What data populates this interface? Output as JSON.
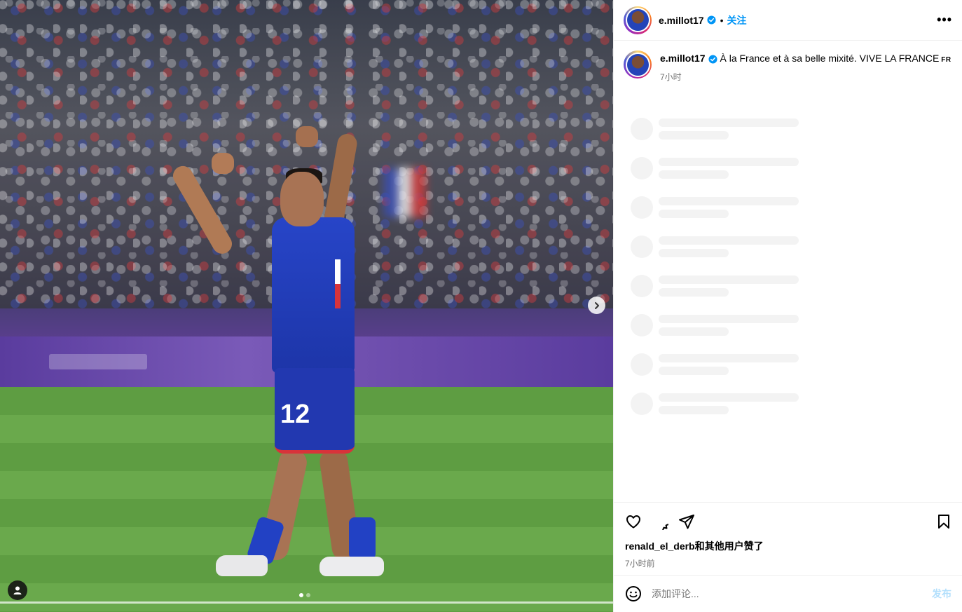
{
  "post": {
    "username": "e.millot17",
    "verified": true,
    "follow_label": "关注",
    "separator": "•",
    "more_label": "•••",
    "caption": {
      "username": "e.millot17",
      "text": "À la France et à sa belle mixité. VIVE LA FRANCE",
      "flag_code": "FR",
      "time": "7小时"
    },
    "media": {
      "jersey_number": "12",
      "carousel_count": 2,
      "carousel_active": 0
    },
    "likes_text": "renald_el_derb和其他用户赞了",
    "post_time": "7小时前",
    "comment_placeholder": "添加评论...",
    "post_button": "发布"
  },
  "colors": {
    "accent": "#0095f6",
    "verified": "#0095f6",
    "muted_text": "#737373",
    "post_disabled": "#b2dffc",
    "skeleton": "#f3f3f3"
  },
  "icons": {
    "like": "heart-icon",
    "comment": "comment-icon",
    "share": "send-icon",
    "save": "bookmark-icon",
    "emoji": "smiley-icon",
    "next": "chevron-right-icon",
    "tag": "user-tag-icon"
  }
}
